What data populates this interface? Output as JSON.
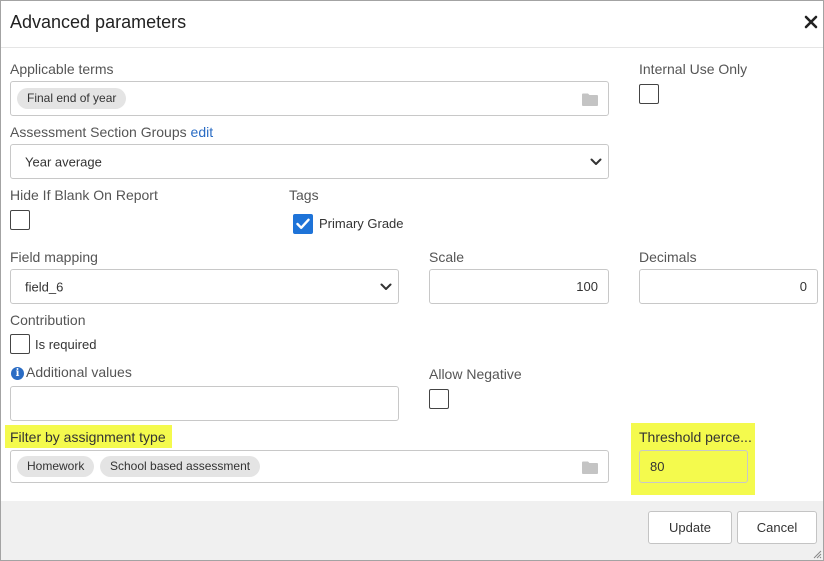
{
  "dialog": {
    "title": "Advanced parameters",
    "close_icon": "close-icon"
  },
  "applicable_terms": {
    "label": "Applicable terms",
    "tags": [
      "Final end of year"
    ],
    "browse_icon": "folder-icon"
  },
  "internal_use_only": {
    "label": "Internal Use Only",
    "checked": false
  },
  "assessment_section_groups": {
    "label": "Assessment Section Groups",
    "edit_link": "edit",
    "selected": "Year average"
  },
  "hide_if_blank": {
    "label": "Hide If Blank On Report",
    "checked": false
  },
  "tags": {
    "label": "Tags",
    "primary_grade_label": "Primary Grade",
    "primary_grade_checked": true
  },
  "field_mapping": {
    "label": "Field mapping",
    "selected": "field_6"
  },
  "scale": {
    "label": "Scale",
    "value": "100"
  },
  "decimals": {
    "label": "Decimals",
    "value": "0"
  },
  "contribution": {
    "label": "Contribution",
    "is_required_label": "Is required",
    "is_required_checked": false
  },
  "additional_values": {
    "label": "Additional values",
    "value": "",
    "info_icon": "info-icon"
  },
  "allow_negative": {
    "label": "Allow Negative",
    "checked": false
  },
  "filter_by_assignment_type": {
    "label": "Filter by assignment type",
    "tags": [
      "Homework",
      "School based assessment"
    ],
    "browse_icon": "folder-icon"
  },
  "threshold_percentage": {
    "label": "Threshold perce...",
    "value": "80"
  },
  "footer": {
    "update_label": "Update",
    "cancel_label": "Cancel"
  },
  "colors": {
    "highlight": "#f4fa4d",
    "checkbox_checked": "#1e73d8",
    "link": "#2a6cc4",
    "footer_bg": "#f0f0f0"
  }
}
